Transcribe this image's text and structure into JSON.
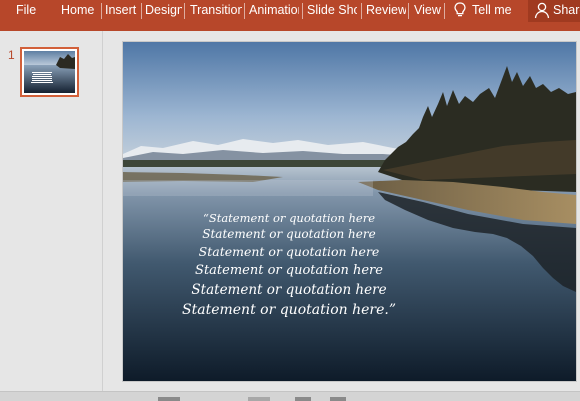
{
  "ribbon": {
    "tabs": [
      {
        "label": "File"
      },
      {
        "label": "Home"
      },
      {
        "label": "Insert"
      },
      {
        "label": "Design"
      },
      {
        "label": "Transitions"
      },
      {
        "label": "Animations"
      },
      {
        "label": "Slide Show"
      },
      {
        "label": "Review"
      },
      {
        "label": "View"
      }
    ],
    "tell_me": "Tell me",
    "share": "Share"
  },
  "thumbnails": {
    "slide_number": "1"
  },
  "slide": {
    "quote_lines": [
      "“Statement or quotation here",
      "Statement or quotation here",
      "Statement or quotation here",
      "Statement or quotation here",
      "Statement or quotation here",
      "Statement or quotation here.”"
    ]
  },
  "colors": {
    "ribbon": "#b7472a",
    "thumbnail_border": "#d2603a"
  }
}
